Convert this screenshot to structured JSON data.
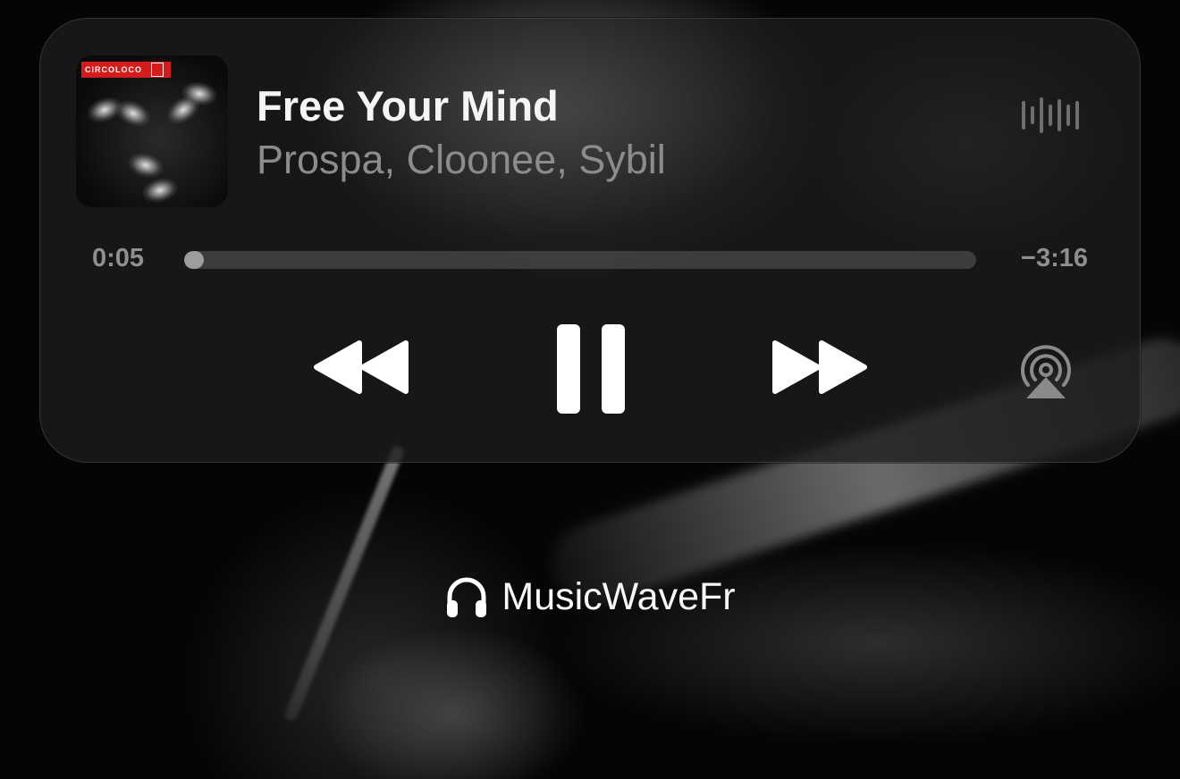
{
  "now_playing": {
    "title": "Free Your Mind",
    "artist": "Prospa, Cloonee, Sybil",
    "artwork": {
      "label_text": "CIRCOLOCO",
      "label_color": "#d51c1c",
      "icon": "album-art"
    },
    "waveform_icon": "waveform-icon"
  },
  "progress": {
    "elapsed": "0:05",
    "remaining": "−3:16",
    "fraction": 0.025
  },
  "controls": {
    "rewind_icon": "rewind-icon",
    "pause_icon": "pause-icon",
    "forward_icon": "forward-icon",
    "airplay_icon": "airplay-icon"
  },
  "footer": {
    "icon": "headphones-icon",
    "label": "MusicWaveFr"
  },
  "colors": {
    "card_background": "#1c1c1c",
    "text_primary": "#f5f5f5",
    "text_secondary": "#8c8c8c",
    "progress_fill": "#9d9d9d"
  }
}
